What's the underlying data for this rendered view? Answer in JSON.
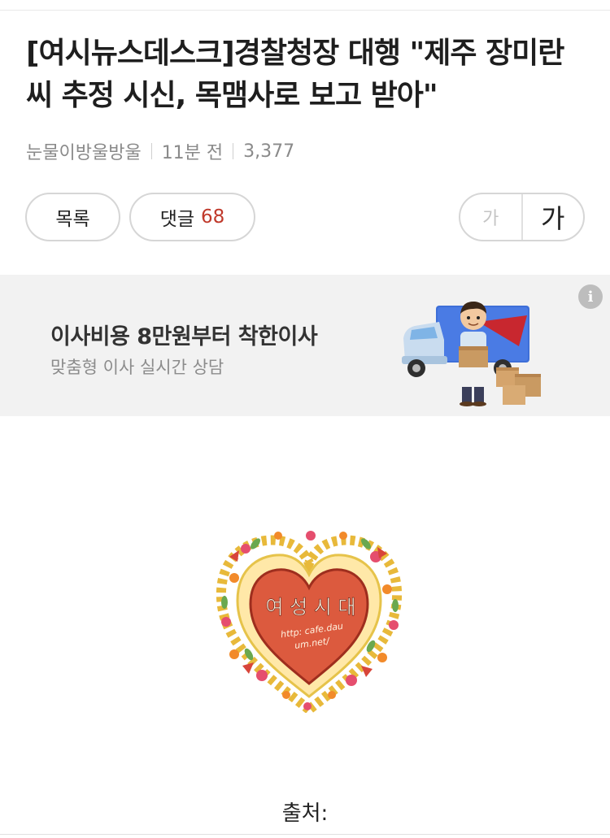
{
  "article": {
    "title": "[여시뉴스데스크]경찰청장 대행 \"제주 장미란씨 추정 시신, 목맴사로 보고 받아\"",
    "author": "눈물이방울방울",
    "time": "11분 전",
    "views": "3,377"
  },
  "actions": {
    "list_label": "목록",
    "comment_label": "댓글",
    "comment_count": "68",
    "font_small": "가",
    "font_large": "가"
  },
  "ad": {
    "title": "이사비용 8만원부터 착한이사",
    "subtitle": "맞춤형 이사 실시간 상담",
    "info_icon": "info-icon"
  },
  "logo": {
    "name": "여성시대",
    "url": "http: cafe.daum.net/"
  },
  "content": {
    "source_label": "출처:"
  },
  "colors": {
    "comment_count": "#c0392b",
    "ad_background": "#f2f2f2",
    "heart_fill": "#dc5a3e"
  }
}
